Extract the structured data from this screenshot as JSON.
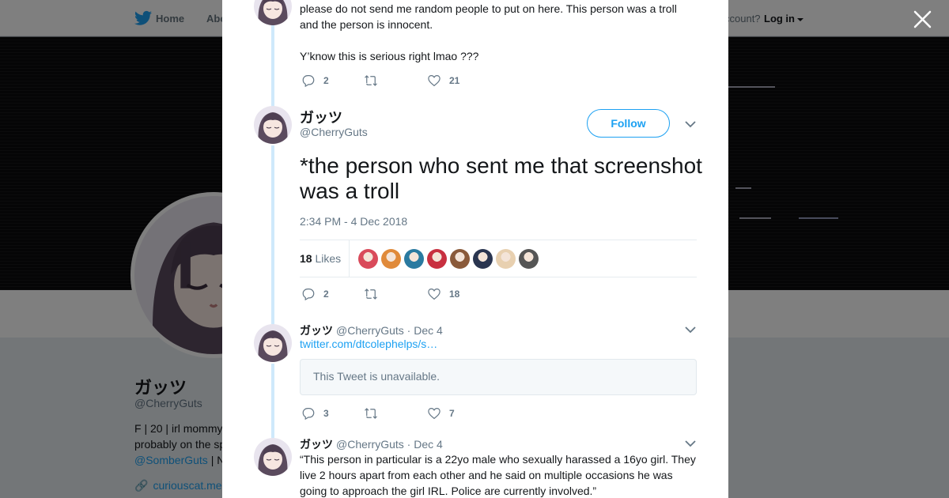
{
  "nav": {
    "home_label": "Home",
    "about_label": "Abo",
    "account_text": "ccount?",
    "login_label": "Log in"
  },
  "profile": {
    "name": "ガッツ",
    "handle": "@CherryGuts",
    "bio_line1": "F | 20 | irl mommy",
    "bio_line2": "probably on the sp",
    "bio_line3_link": "@SomberGuts",
    "bio_line3_rest": " | N",
    "link": "curiouscat.me"
  },
  "colors": {
    "accent": "#1da1f2",
    "thread_line": "#cfe9fb",
    "secondary_text": "#657786",
    "overlay": "rgba(0,0,0,0.5)"
  },
  "tweets": {
    "previous": {
      "text_line1": "please do not send me random people to put on here. This person was a troll",
      "text_line2": "and the person is innocent.",
      "text_line3": "Y’know this is serious right lmao ???",
      "reply_count": "2",
      "retweet_count": "",
      "like_count": "21"
    },
    "main": {
      "name": "ガッツ",
      "handle": "@CherryGuts",
      "follow_label": "Follow",
      "text": "*the person who sent me that screenshot was a troll",
      "timestamp": "2:34 PM - 4 Dec 2018",
      "likes_count": "18",
      "likes_label": "Likes",
      "reply_count": "2",
      "retweet_count": "",
      "like_count": "18",
      "likers": [
        {
          "color": "#d94a5a"
        },
        {
          "color": "#e08a3a"
        },
        {
          "color": "#2a7aa0"
        },
        {
          "color": "#c83040"
        },
        {
          "color": "#8a5a3a"
        },
        {
          "color": "#2a3550"
        },
        {
          "color": "#e8d0b0"
        },
        {
          "color": "#555555"
        }
      ]
    },
    "reply1": {
      "name": "ガッツ",
      "meta": "@CherryGuts · Dec 4",
      "link_text": "twitter.com/dtcolephelps/s…",
      "unavailable_text": "This Tweet is unavailable.",
      "reply_count": "3",
      "retweet_count": "",
      "like_count": "7"
    },
    "reply2": {
      "name": "ガッツ",
      "meta": "@CherryGuts · Dec 4",
      "text_line1": "“This person in particular is a 22yo male who sexually harassed a 16yo girl. They",
      "text_line2": "live 2 hours apart from each other and he said on multiple occasions he was",
      "text_line3": "going to approach the girl IRL. Police are currently involved.”"
    }
  },
  "icons": {
    "logo": "twitter-bird-icon",
    "close": "close-icon",
    "reply": "reply-icon",
    "retweet": "retweet-icon",
    "like": "heart-icon",
    "more": "chevron-down-icon",
    "link": "link-icon"
  }
}
